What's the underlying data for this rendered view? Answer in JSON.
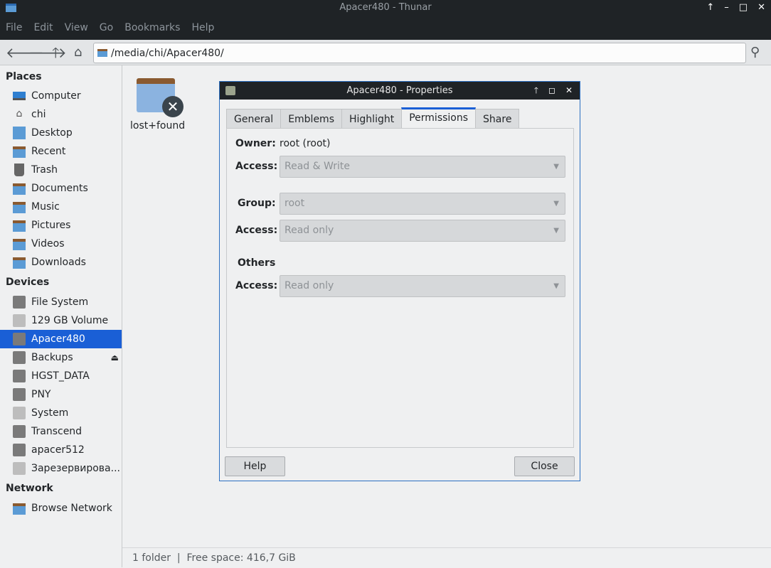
{
  "window": {
    "title": "Apacer480 - Thunar"
  },
  "menu": [
    "File",
    "Edit",
    "View",
    "Go",
    "Bookmarks",
    "Help"
  ],
  "address": "/media/chi/Apacer480/",
  "sidebar": {
    "places_header": "Places",
    "places": [
      "Computer",
      "chi",
      "Desktop",
      "Recent",
      "Trash",
      "Documents",
      "Music",
      "Pictures",
      "Videos",
      "Downloads"
    ],
    "devices_header": "Devices",
    "devices": [
      "File System",
      "129 GB Volume",
      "Apacer480",
      "Backups",
      "HGST_DATA",
      "PNY",
      "System",
      "Transcend",
      "apacer512",
      "Зарезервирова..."
    ],
    "network_header": "Network",
    "network": [
      "Browse Network"
    ]
  },
  "files": [
    {
      "name": "lost+found"
    }
  ],
  "status": "1 folder  |  Free space: 416,7 GiB",
  "dialog": {
    "title": "Apacer480 - Properties",
    "tabs": [
      "General",
      "Emblems",
      "Highlight",
      "Permissions",
      "Share"
    ],
    "active_tab": "Permissions",
    "owner_label": "Owner:",
    "owner_value": "root (root)",
    "access_label": "Access:",
    "owner_access": "Read & Write",
    "group_label": "Group:",
    "group_value": "root",
    "group_access": "Read only",
    "others_label": "Others",
    "others_access": "Read only",
    "help": "Help",
    "close": "Close"
  }
}
